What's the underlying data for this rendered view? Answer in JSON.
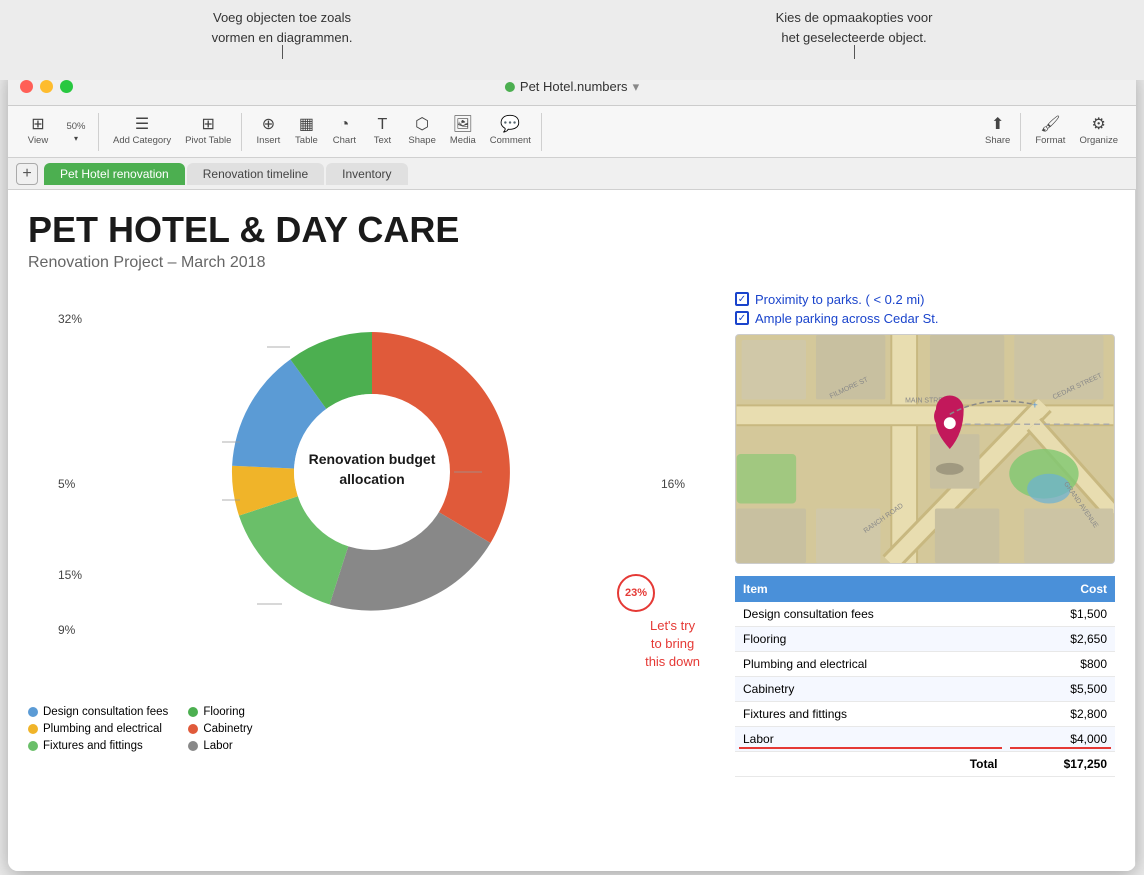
{
  "tooltips": {
    "left": {
      "line1": "Voeg objecten toe zoals",
      "line2": "vormen en diagrammen."
    },
    "right": {
      "line1": "Kies de opmaakopties voor",
      "line2": "het geselecteerde object."
    }
  },
  "window": {
    "title": "Pet Hotel.numbers",
    "title_icon": "🟢"
  },
  "toolbar": {
    "view_label": "View",
    "zoom_label": "50%",
    "add_category_label": "Add Category",
    "pivot_table_label": "Pivot Table",
    "insert_label": "Insert",
    "table_label": "Table",
    "chart_label": "Chart",
    "text_label": "Text",
    "shape_label": "Shape",
    "media_label": "Media",
    "comment_label": "Comment",
    "share_label": "Share",
    "format_label": "Format",
    "organize_label": "Organize"
  },
  "tabs": {
    "add_label": "+",
    "items": [
      {
        "label": "Pet Hotel renovation",
        "active": true
      },
      {
        "label": "Renovation timeline",
        "active": false
      },
      {
        "label": "Inventory",
        "active": false
      }
    ]
  },
  "sheet": {
    "title": "PET HOTEL & DAY CARE",
    "subtitle": "Renovation Project – March 2018"
  },
  "chart": {
    "title": "Renovation budget\nallocation",
    "segments": [
      {
        "label": "Design consultation fees",
        "color": "#5b9bd5",
        "percent": 9
      },
      {
        "label": "Plumbing and electrical",
        "color": "#f0b429",
        "percent": 5
      },
      {
        "label": "Fixtures and fittings",
        "color": "#6abf69",
        "percent": 15
      },
      {
        "label": "Flooring",
        "color": "#4caf50",
        "percent": 16
      },
      {
        "label": "Cabinetry",
        "color": "#e05a3a",
        "percent": 32
      },
      {
        "label": "Labor",
        "color": "#888",
        "percent": 23
      }
    ],
    "labels": {
      "top_left": "32%",
      "mid_left_top": "5%",
      "mid_left_bottom": "15%",
      "bottom_left": "9%",
      "mid_right": "16%",
      "bottom_right": "23%"
    }
  },
  "checklist": {
    "items": [
      {
        "text": "Proximity to parks. ( < 0.2 mi)",
        "checked": true
      },
      {
        "text": "Ample parking across  Cedar St.",
        "checked": true
      }
    ]
  },
  "table": {
    "headers": [
      "Item",
      "Cost"
    ],
    "rows": [
      {
        "item": "Design consultation fees",
        "cost": "$1,500"
      },
      {
        "item": "Flooring",
        "cost": "$2,650"
      },
      {
        "item": "Plumbing and electrical",
        "cost": "$800"
      },
      {
        "item": "Cabinetry",
        "cost": "$5,500"
      },
      {
        "item": "Fixtures and fittings",
        "cost": "$2,800"
      },
      {
        "item": "Labor",
        "cost": "$4,000",
        "underline": true
      }
    ],
    "total_label": "Total",
    "total_value": "$17,250"
  },
  "annotation": {
    "circled_value": "23%",
    "text_line1": "Let's try",
    "text_line2": "to bring",
    "text_line3": "this down"
  },
  "colors": {
    "blue_tab": "#4caf50",
    "map_bg": "#d4c89a",
    "table_header": "#4a90d9"
  }
}
